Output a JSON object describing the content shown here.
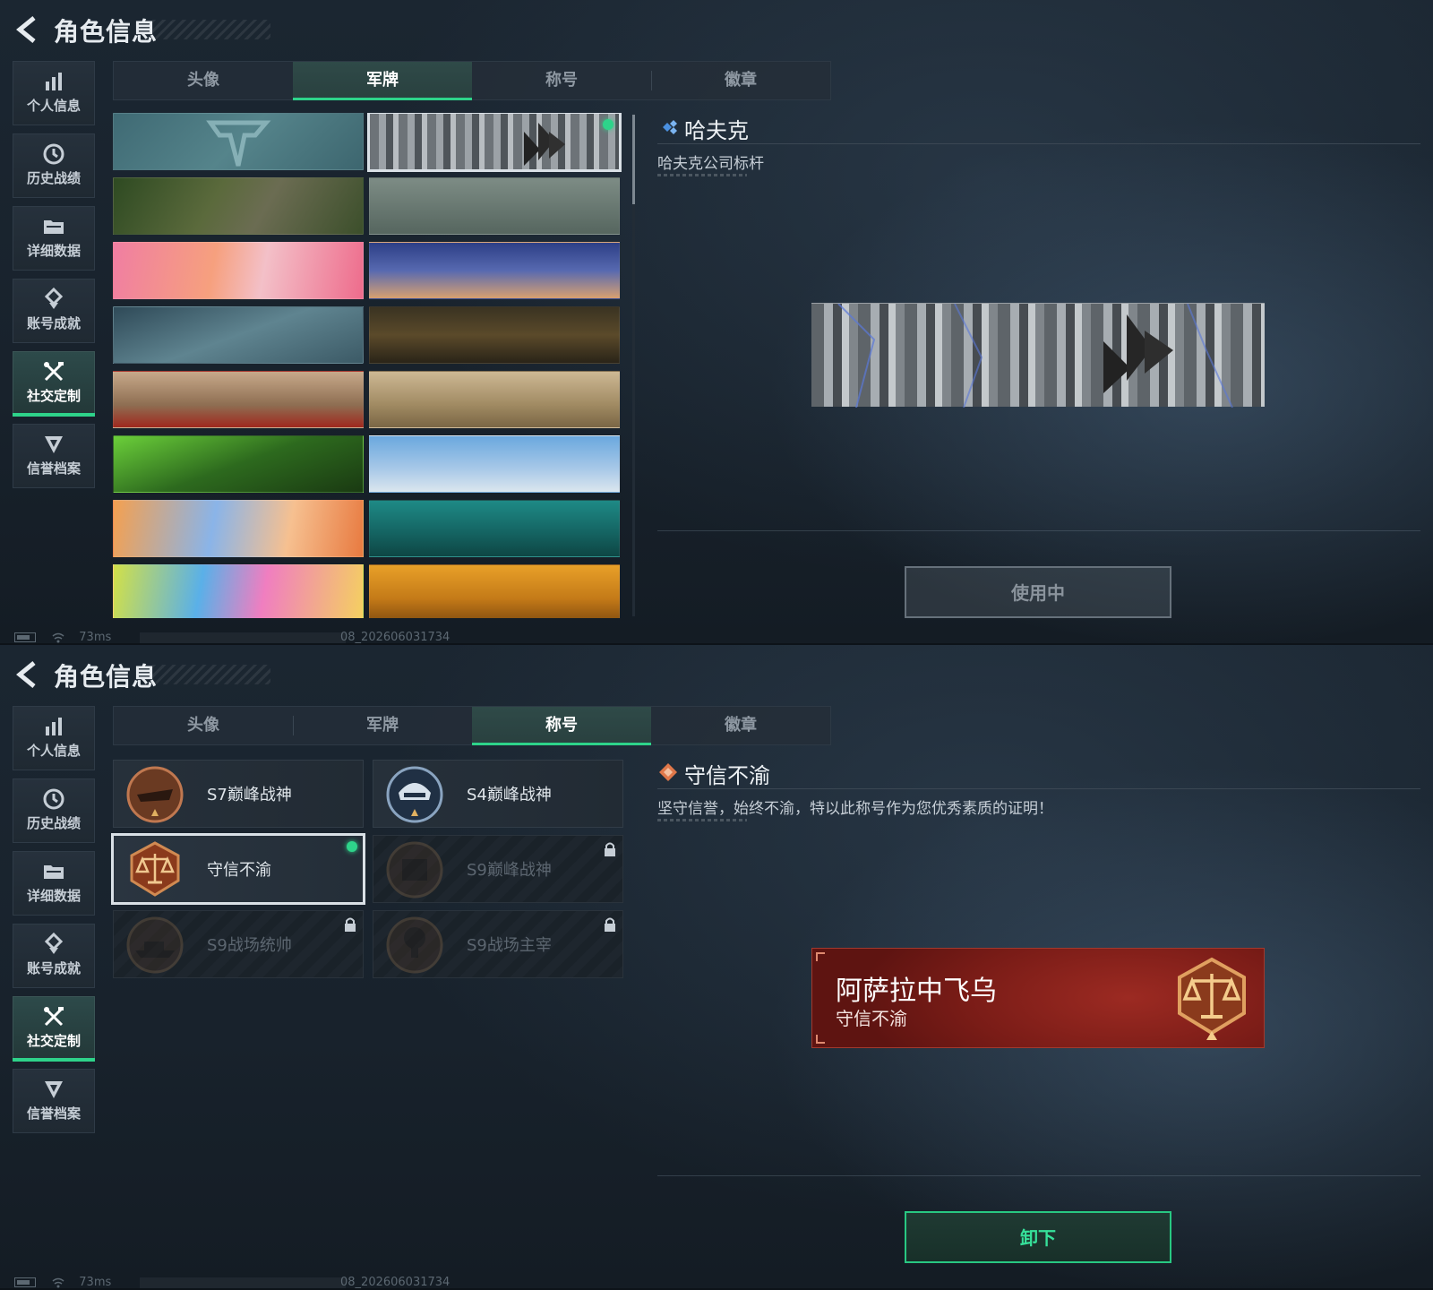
{
  "colors": {
    "accent": "#2ed38a",
    "bg": "#18222c",
    "nameplate_red": "#8c2019"
  },
  "panel1": {
    "header": {
      "title": "角色信息",
      "back_icon": "chevron-left-icon"
    },
    "sidebar": [
      {
        "label": "个人信息",
        "icon": "bar-chart-icon"
      },
      {
        "label": "历史战绩",
        "icon": "clock-icon"
      },
      {
        "label": "详细数据",
        "icon": "folder-icon"
      },
      {
        "label": "账号成就",
        "icon": "medal-icon"
      },
      {
        "label": "社交定制",
        "icon": "tools-icon",
        "active": true
      },
      {
        "label": "信誉档案",
        "icon": "shield-icon"
      }
    ],
    "tabs": [
      "头像",
      "军牌",
      "称号",
      "徽章"
    ],
    "active_tab": "军牌",
    "detail": {
      "name": "哈夫克",
      "desc": "哈夫克公司标杆"
    },
    "action_button": "使用中",
    "status": {
      "ping": "73ms",
      "build": "08_202606031734"
    }
  },
  "panel2": {
    "header": {
      "title": "角色信息",
      "back_icon": "chevron-left-icon"
    },
    "sidebar": [
      {
        "label": "个人信息",
        "icon": "bar-chart-icon"
      },
      {
        "label": "历史战绩",
        "icon": "clock-icon"
      },
      {
        "label": "详细数据",
        "icon": "folder-icon"
      },
      {
        "label": "账号成就",
        "icon": "medal-icon"
      },
      {
        "label": "社交定制",
        "icon": "tools-icon",
        "active": true
      },
      {
        "label": "信誉档案",
        "icon": "shield-icon"
      }
    ],
    "tabs": [
      "头像",
      "军牌",
      "称号",
      "徽章"
    ],
    "active_tab": "称号",
    "titles": [
      {
        "name": "S7巅峰战神",
        "locked": false,
        "selected": false
      },
      {
        "name": "S4巅峰战神",
        "locked": false,
        "selected": false
      },
      {
        "name": "守信不渝",
        "locked": false,
        "selected": true
      },
      {
        "name": "S9巅峰战神",
        "locked": true,
        "selected": false
      },
      {
        "name": "S9战场统帅",
        "locked": true,
        "selected": false
      },
      {
        "name": "S9战场主宰",
        "locked": true,
        "selected": false
      }
    ],
    "detail": {
      "name": "守信不渝",
      "desc": "坚守信誉，始终不渝，特以此称号作为您优秀素质的证明！"
    },
    "nameplate": {
      "player": "阿萨拉中飞乌",
      "title": "守信不渝"
    },
    "action_button": "卸下",
    "status": {
      "ping": "73ms",
      "build": "08_202606031734"
    }
  }
}
